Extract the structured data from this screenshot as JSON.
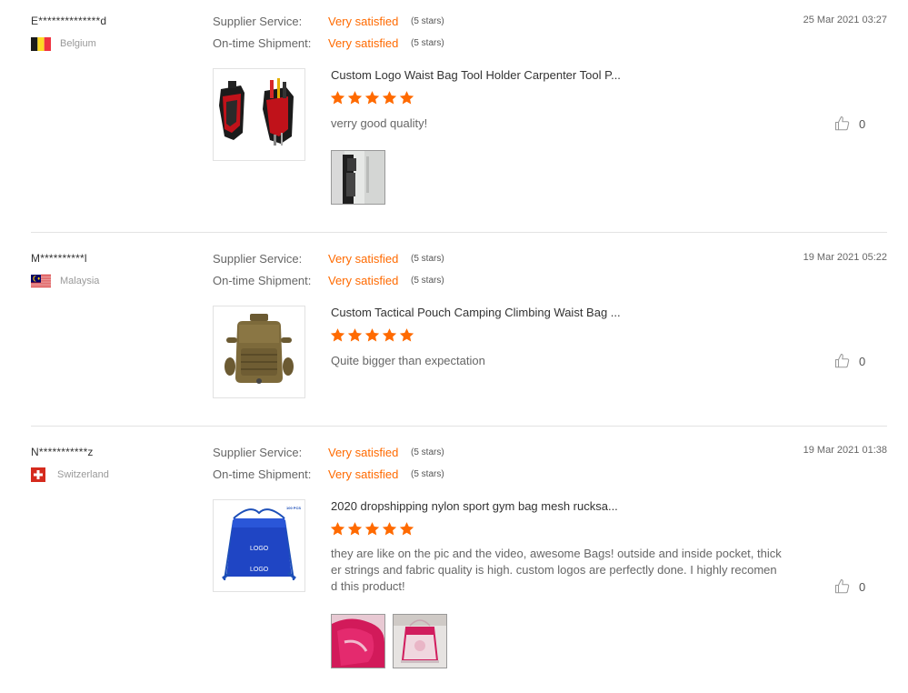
{
  "labels": {
    "supplier_service": "Supplier Service:",
    "ontime_shipment": "On-time Shipment:"
  },
  "colors": {
    "accent": "#ff6a00",
    "divider": "#e3e3e3"
  },
  "reviews": [
    {
      "buyer": "E**************d",
      "country": "Belgium",
      "flag": "belgium-flag",
      "supplier_service": "Very satisfied",
      "supplier_service_stars": "(5 stars)",
      "shipment": "Very satisfied",
      "shipment_stars": "(5 stars)",
      "date": "25 Mar 2021 03:27",
      "product_title": "Custom Logo Waist Bag Tool Holder Carpenter Tool P...",
      "rating": 5,
      "text": "verry good quality!",
      "likes": "0",
      "photo_count": 1
    },
    {
      "buyer": "M**********l",
      "country": "Malaysia",
      "flag": "malaysia-flag",
      "supplier_service": "Very satisfied",
      "supplier_service_stars": "(5 stars)",
      "shipment": "Very satisfied",
      "shipment_stars": "(5 stars)",
      "date": "19 Mar 2021 05:22",
      "product_title": "Custom Tactical Pouch Camping Climbing Waist Bag ...",
      "rating": 5,
      "text": "Quite bigger than expectation",
      "likes": "0",
      "photo_count": 0
    },
    {
      "buyer": "N***********z",
      "country": "Switzerland",
      "flag": "switzerland-flag",
      "supplier_service": "Very satisfied",
      "supplier_service_stars": "(5 stars)",
      "shipment": "Very satisfied",
      "shipment_stars": "(5 stars)",
      "date": "19 Mar 2021 01:38",
      "product_title": "2020 dropshipping nylon sport gym bag mesh rucksa...",
      "product_image_text": {
        "badge": "100 PCS",
        "logo1": "LOGO",
        "logo2": "LOGO"
      },
      "rating": 5,
      "text": "they are like on the pic and the video, awesome Bags! outside and inside pocket, thicker strings and fabric quality is high. custom logos are perfectly done. I highly recomend this product!",
      "likes": "0",
      "photo_count": 2
    }
  ]
}
